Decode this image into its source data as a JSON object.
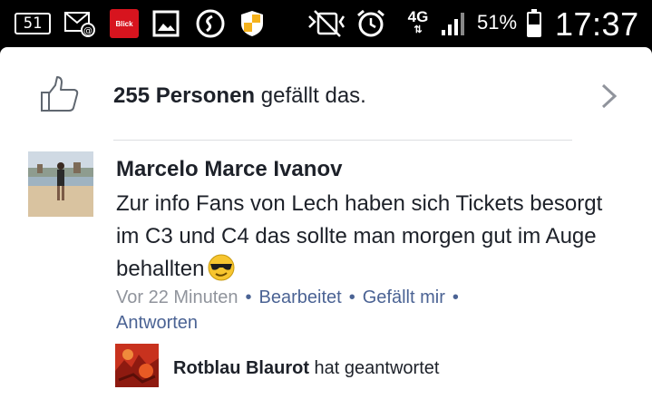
{
  "status_bar": {
    "notification_count": "51",
    "blick_label": "Blick",
    "network": "4G",
    "battery_percent": "51%",
    "battery_level": 0.51,
    "time": "17:37",
    "icons": [
      "notification-count-icon",
      "email-icon",
      "blick-app-icon",
      "gallery-icon",
      "shazam-icon",
      "shield-icon",
      "vibrate-icon",
      "alarm-icon",
      "network-4g-icon",
      "signal-icon",
      "battery-icon"
    ]
  },
  "likes": {
    "count_label": "255 Personen",
    "suffix": " gefällt das."
  },
  "comment": {
    "author": "Marcelo Marce Ivanov",
    "text": "Zur info Fans von Lech haben sich Tickets besorgt im C3  und C4 das sollte man morgen gut im Auge behallten",
    "emoji": "sunglasses-emoji",
    "time": "Vor 22 Minuten",
    "edited": "Bearbeitet",
    "like_action": "Gefällt mir",
    "reply_action": "Antworten"
  },
  "reply": {
    "author": "Rotblau Blaurot",
    "action_text": " hat geantwortet"
  },
  "colors": {
    "link": "#4b6394",
    "meta": "#90949c",
    "text": "#1d2129",
    "blick": "#d7141e"
  }
}
